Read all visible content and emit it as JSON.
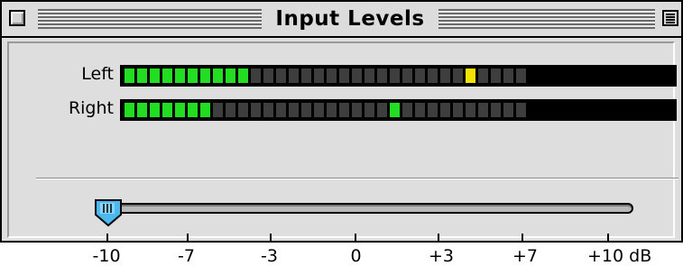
{
  "window": {
    "title": "Input Levels"
  },
  "meters": {
    "left": {
      "label": "Left",
      "level_segments": 10,
      "peak_segment": 27,
      "peak_color": "#f2e400"
    },
    "right": {
      "label": "Right",
      "level_segments": 7,
      "peak_segment": 21,
      "peak_color": "#22dd22"
    },
    "total_segments": 32
  },
  "slider": {
    "scale_labels": [
      "-10",
      "-7",
      "-3",
      "0",
      "+3",
      "+7",
      "+10 dB"
    ],
    "value_label": "-10"
  },
  "colors": {
    "segment_on": "#22dd22",
    "segment_off": "#3e3e3e",
    "thumb": "#4cb8f0"
  }
}
